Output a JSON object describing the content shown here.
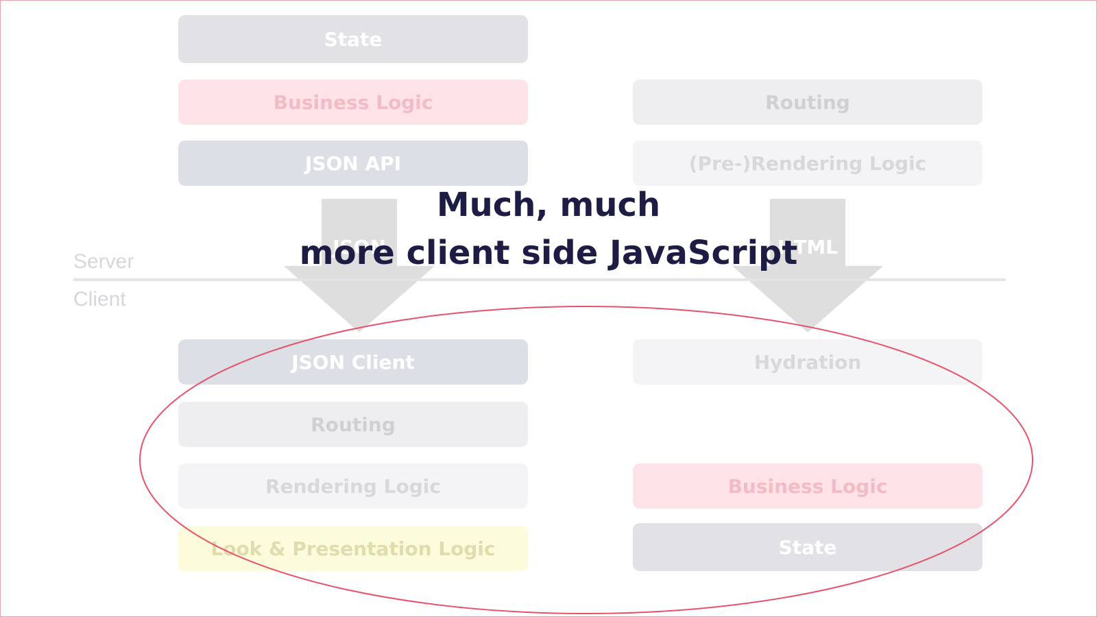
{
  "headline": {
    "line1": "Much, much",
    "line2": "more client side JavaScript"
  },
  "labels": {
    "server": "Server",
    "client": "Client"
  },
  "left_column": {
    "server_boxes": [
      "State",
      "Business Logic",
      "JSON API"
    ],
    "transfer": "JSON",
    "client_boxes": [
      "JSON Client",
      "Routing",
      "Rendering Logic",
      "Look & Presentation Logic"
    ]
  },
  "right_column": {
    "server_boxes": [
      "Routing",
      "(Pre-)Rendering Logic"
    ],
    "transfer": "HTML",
    "client_boxes": [
      "Hydration",
      "Business Logic",
      "State"
    ]
  },
  "colors": {
    "headline": "#1c1c44",
    "highlight_ellipse": "#e8516a",
    "state": "#e1e1e6",
    "business_logic": "#fde3e8",
    "json": "#dcdfe6",
    "routing": "#eeeef0",
    "rendering": "#f4f4f6",
    "look": "#fcfbdc"
  }
}
